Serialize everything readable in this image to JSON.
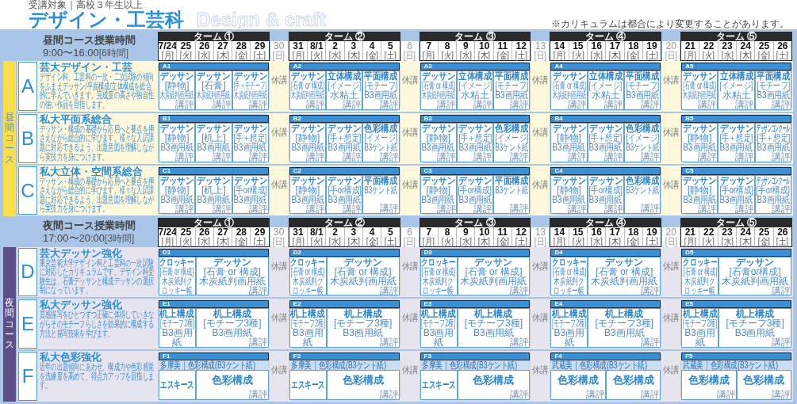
{
  "header": {
    "audience": "受講対象｜高校３年生以上",
    "title": "デザイン・工芸科",
    "title_en": "Design & craft",
    "note": "※カリキュラムは都合により変更することがあります。"
  },
  "sections": [
    {
      "kind": "day",
      "band": "昼間コース",
      "hours_title": "昼間コース授業時間",
      "hours": "9:00〜16:00",
      "duration": "[6時間]",
      "terms": [
        {
          "label": "ターム ①",
          "days": [
            {
              "date": "7/24",
              "weekday": "[月]"
            },
            {
              "date": "25",
              "weekday": "[火]"
            },
            {
              "date": "26",
              "weekday": "[水]"
            },
            {
              "date": "27",
              "weekday": "[木]"
            },
            {
              "date": "28",
              "weekday": "[金]"
            },
            {
              "date": "29",
              "weekday": "[土]"
            }
          ]
        },
        {
          "label": "ターム ②",
          "days": [
            {
              "date": "31",
              "weekday": "[月]"
            },
            {
              "date": "8/1",
              "weekday": "[火]"
            },
            {
              "date": "2",
              "weekday": "[水]"
            },
            {
              "date": "3",
              "weekday": "[木]"
            },
            {
              "date": "4",
              "weekday": "[金]"
            },
            {
              "date": "5",
              "weekday": "[土]"
            }
          ]
        },
        {
          "label": "ターム ③",
          "days": [
            {
              "date": "7",
              "weekday": "[月]"
            },
            {
              "date": "8",
              "weekday": "[火]"
            },
            {
              "date": "9",
              "weekday": "[水]"
            },
            {
              "date": "10",
              "weekday": "[木]"
            },
            {
              "date": "11",
              "weekday": "[金]"
            },
            {
              "date": "12",
              "weekday": "[土]"
            }
          ]
        },
        {
          "label": "ターム ④",
          "days": [
            {
              "date": "14",
              "weekday": "[月]"
            },
            {
              "date": "15",
              "weekday": "[火]"
            },
            {
              "date": "16",
              "weekday": "[水]"
            },
            {
              "date": "17",
              "weekday": "[木]"
            },
            {
              "date": "18",
              "weekday": "[金]"
            },
            {
              "date": "19",
              "weekday": "[土]"
            }
          ]
        },
        {
          "label": "ターム ⑤",
          "days": [
            {
              "date": "21",
              "weekday": "[月]"
            },
            {
              "date": "22",
              "weekday": "[火]"
            },
            {
              "date": "23",
              "weekday": "[水]"
            },
            {
              "date": "24",
              "weekday": "[木]"
            },
            {
              "date": "25",
              "weekday": "[金]"
            },
            {
              "date": "26",
              "weekday": "[土]"
            }
          ]
        }
      ],
      "rest_days": [
        {
          "date": "30",
          "weekday": "[日]"
        },
        {
          "date": "6",
          "weekday": "[日]"
        },
        {
          "date": "13",
          "weekday": "[日]"
        },
        {
          "date": "20",
          "weekday": "[日]"
        }
      ],
      "courses": [
        {
          "letter": "A",
          "title": "芸大デザイン・工芸",
          "description": "デザイン科、工芸科の一次・二次試験の傾向をふまえデッサン/平面構成/立体構成を総合的に学んでいきます。完成度の高さや独自性の強い作品を目指します。",
          "breaks": [
            "休講",
            "休講",
            "休講",
            "休講"
          ],
          "sessions": [
            {
              "code": "A1",
              "cells": [
                {
                  "kind": "narrow",
                  "title": "デッサン",
                  "sub": "[静物]",
                  "material": "木炭紙判画用紙",
                  "review": "講評"
                },
                {
                  "kind": "narrow",
                  "title": "デッサン",
                  "sub": "[石膏]",
                  "material": "木炭紙判画用紙",
                  "review": "講評"
                },
                {
                  "kind": "narrow",
                  "title": "デッサン",
                  "sub": "[手＋モチーフ]",
                  "material": "木炭紙判画用紙",
                  "review": "講評"
                }
              ]
            },
            {
              "code": "A2",
              "cells": [
                {
                  "kind": "narrow",
                  "title": "デッサン",
                  "sub": "[石膏 or 構成]",
                  "material": "木炭紙判画用紙",
                  "review": "講評"
                },
                {
                  "kind": "narrow",
                  "title": "立体構成",
                  "sub": "[イメージ]",
                  "material": "水粘土",
                  "review": "講評"
                },
                {
                  "kind": "narrow",
                  "title": "平面構成",
                  "sub": "[モチーフ]",
                  "material": "B3画用紙",
                  "review": "講評"
                }
              ]
            },
            {
              "code": "A3",
              "cells": [
                {
                  "kind": "narrow",
                  "title": "デッサン",
                  "sub": "[石膏 or 構成]",
                  "material": "木炭紙判画用紙",
                  "review": "講評"
                },
                {
                  "kind": "narrow",
                  "title": "立体構成",
                  "sub": "[イメージ]",
                  "material": "水粘土",
                  "review": "講評"
                },
                {
                  "kind": "narrow",
                  "title": "平面構成",
                  "sub": "[モチーフ]",
                  "material": "B3画用紙",
                  "review": "講評"
                }
              ]
            },
            {
              "code": "A4",
              "cells": [
                {
                  "kind": "narrow",
                  "title": "デッサン",
                  "sub": "[石膏 or 構成]",
                  "material": "木炭紙判画用紙",
                  "review": "講評"
                },
                {
                  "kind": "narrow",
                  "title": "立体構成",
                  "sub": "[イメージ]",
                  "material": "水粘土",
                  "review": "講評"
                },
                {
                  "kind": "narrow",
                  "title": "平面構成",
                  "sub": "[モチーフ]",
                  "material": "B3画用紙",
                  "review": "講評"
                }
              ]
            },
            {
              "code": "A5",
              "cells": [
                {
                  "kind": "narrow",
                  "title": "デッサン",
                  "sub": "[石膏 or 構成]",
                  "material": "木炭紙判画用紙",
                  "review": "講評"
                },
                {
                  "kind": "narrow",
                  "title": "立体構成",
                  "sub": "[イメージ]",
                  "material": "水粘土",
                  "review": "講評"
                },
                {
                  "kind": "narrow",
                  "title": "平面構成",
                  "sub": "[モチーフ]",
                  "material": "B3画用紙",
                  "review": "講評"
                }
              ]
            }
          ]
        },
        {
          "letter": "B",
          "title": "私大平面系総合",
          "description": "デッサン・構成の基礎から応用へと要点を押さえながら総合的に学びます。様々な入試課題に対応できるよう、出題意図を理解しながら実技力を身につけます。",
          "breaks": [
            "休講",
            "休講",
            "休講",
            "休講"
          ],
          "sessions": [
            {
              "code": "B1",
              "cells": [
                {
                  "kind": "narrow",
                  "title": "デッサン",
                  "sub": "[静物]",
                  "material": "B3画用紙",
                  "review": "講評"
                },
                {
                  "kind": "narrow",
                  "title": "デッサン",
                  "sub": "[机上]",
                  "material": "B3画用紙",
                  "review": "講評"
                },
                {
                  "kind": "narrow",
                  "title": "デッサン",
                  "sub": "[手＋想定]",
                  "material": "B3画用紙",
                  "review": "講評"
                }
              ]
            },
            {
              "code": "B2",
              "cells": [
                {
                  "kind": "narrow",
                  "title": "デッサン",
                  "sub": "[静物]",
                  "material": "B3画用紙",
                  "review": "講評"
                },
                {
                  "kind": "narrow",
                  "title": "デッサン",
                  "sub": "[手＋想定]",
                  "material": "B3画用紙",
                  "review": "講評"
                },
                {
                  "kind": "narrow",
                  "title": "色彩構成",
                  "sub": "[イメージ]",
                  "material": "B3ケント紙",
                  "review": "講評"
                }
              ]
            },
            {
              "code": "B3",
              "cells": [
                {
                  "kind": "narrow",
                  "title": "デッサン",
                  "sub": "[静物]",
                  "material": "B3画用紙",
                  "review": "講評"
                },
                {
                  "kind": "narrow",
                  "title": "デッサン",
                  "sub": "[手＋想定]",
                  "material": "B3画用紙",
                  "review": "講評"
                },
                {
                  "kind": "narrow",
                  "title": "色彩構成",
                  "sub": "[イメージ]",
                  "material": "B3ケント紙",
                  "review": "講評"
                }
              ]
            },
            {
              "code": "B4",
              "cells": [
                {
                  "kind": "narrow",
                  "title": "デッサン",
                  "sub": "[静物]",
                  "material": "B3画用紙",
                  "review": "講評"
                },
                {
                  "kind": "narrow",
                  "title": "デッサン",
                  "sub": "[手＋想定]",
                  "material": "B3画用紙",
                  "review": "講評"
                },
                {
                  "kind": "narrow",
                  "title": "色彩構成",
                  "sub": "[イメージ]",
                  "material": "B3ケント紙",
                  "review": "講評"
                }
              ]
            },
            {
              "code": "B5",
              "cells": [
                {
                  "kind": "narrow",
                  "title": "デッサン",
                  "sub": "[静物]",
                  "material": "B3画用紙",
                  "review": "講評"
                },
                {
                  "kind": "narrow",
                  "title": "デッサン",
                  "sub": "[手＋想定]",
                  "material": "B3画用紙",
                  "review": "講評"
                },
                {
                  "kind": "narrow",
                  "title": "デッサンコンクール",
                  "sub": "[手＋想定]",
                  "material": "B3画用紙",
                  "review": "講評"
                }
              ]
            }
          ]
        },
        {
          "letter": "C",
          "title": "私大立体・空間系総合",
          "description": "デッサン・構成の基礎から応用へと要点を押さえながら総合的に学びます。様々な入試課題に対応できるよう、出題意図を理解しながら実技力を身につけます。",
          "breaks": [
            "休講",
            "休講",
            "休講",
            "休講"
          ],
          "sessions": [
            {
              "code": "C1",
              "cells": [
                {
                  "kind": "narrow",
                  "title": "デッサン",
                  "sub": "[静物]",
                  "material": "B3画用紙",
                  "review": "講評"
                },
                {
                  "kind": "narrow",
                  "title": "デッサン",
                  "sub": "[机上]",
                  "material": "B3画用紙",
                  "review": "講評"
                },
                {
                  "kind": "narrow",
                  "title": "デッサン",
                  "sub": "[手or構成]",
                  "material": "B3画用紙",
                  "review": "講評"
                }
              ]
            },
            {
              "code": "C2",
              "cells": [
                {
                  "kind": "narrow",
                  "title": "デッサン",
                  "sub": "[静物]",
                  "material": "B3画用紙",
                  "review": "講評"
                },
                {
                  "kind": "narrow",
                  "title": "デッサン",
                  "sub": "[手or構成]",
                  "material": "B3画用紙",
                  "review": "講評"
                },
                {
                  "kind": "narrow",
                  "title": "平面構成",
                  "material": "B3ケント紙",
                  "review": "講評"
                }
              ]
            },
            {
              "code": "C3",
              "cells": [
                {
                  "kind": "narrow",
                  "title": "デッサン",
                  "sub": "[静物]",
                  "material": "B3画用紙",
                  "review": "講評"
                },
                {
                  "kind": "narrow",
                  "title": "デッサン",
                  "sub": "[手or構成]",
                  "material": "B3画用紙",
                  "review": "講評"
                },
                {
                  "kind": "narrow",
                  "title": "平面構成",
                  "material": "B3ケント紙",
                  "review": "講評"
                }
              ]
            },
            {
              "code": "C4",
              "cells": [
                {
                  "kind": "narrow",
                  "title": "デッサン",
                  "sub": "[静物]",
                  "material": "B3画用紙",
                  "review": "講評"
                },
                {
                  "kind": "narrow",
                  "title": "デッサン",
                  "sub": "[手or構成]",
                  "material": "B3画用紙",
                  "review": "講評"
                },
                {
                  "kind": "narrow",
                  "title": "色彩構成",
                  "material": "B3ケント紙",
                  "review": "講評"
                }
              ]
            },
            {
              "code": "C5",
              "cells": [
                {
                  "kind": "narrow",
                  "title": "デッサン",
                  "sub": "[静物]",
                  "material": "B3画用紙",
                  "review": "講評"
                },
                {
                  "kind": "narrow",
                  "title": "デッサン",
                  "sub": "[手or構成]",
                  "material": "B3画用紙",
                  "review": "講評"
                },
                {
                  "kind": "narrow",
                  "title": "デッサンコンクール",
                  "sub": "[手or構成]",
                  "material": "B3画用紙",
                  "review": "講評"
                }
              ]
            }
          ]
        }
      ]
    },
    {
      "kind": "night",
      "band": "夜間コース",
      "hours_title": "夜間コース授業時間",
      "hours": "17:00〜20:00",
      "duration": "[3時間]",
      "terms": [
        {
          "label": "ターム ①",
          "days": [
            {
              "date": "7/24",
              "weekday": "[月]"
            },
            {
              "date": "25",
              "weekday": "[火]"
            },
            {
              "date": "26",
              "weekday": "[水]"
            },
            {
              "date": "27",
              "weekday": "[木]"
            },
            {
              "date": "28",
              "weekday": "[金]"
            },
            {
              "date": "29",
              "weekday": "[土]"
            }
          ]
        },
        {
          "label": "ターム ②",
          "days": [
            {
              "date": "31",
              "weekday": "[月]"
            },
            {
              "date": "8/1",
              "weekday": "[火]"
            },
            {
              "date": "2",
              "weekday": "[水]"
            },
            {
              "date": "3",
              "weekday": "[木]"
            },
            {
              "date": "4",
              "weekday": "[金]"
            },
            {
              "date": "5",
              "weekday": "[土]"
            }
          ]
        },
        {
          "label": "ターム ③",
          "days": [
            {
              "date": "7",
              "weekday": "[月]"
            },
            {
              "date": "8",
              "weekday": "[火]"
            },
            {
              "date": "9",
              "weekday": "[水]"
            },
            {
              "date": "10",
              "weekday": "[木]"
            },
            {
              "date": "11",
              "weekday": "[金]"
            },
            {
              "date": "12",
              "weekday": "[土]"
            }
          ]
        },
        {
          "label": "ターム ④",
          "days": [
            {
              "date": "14",
              "weekday": "[月]"
            },
            {
              "date": "15",
              "weekday": "[火]"
            },
            {
              "date": "16",
              "weekday": "[水]"
            },
            {
              "date": "17",
              "weekday": "[木]"
            },
            {
              "date": "18",
              "weekday": "[金]"
            },
            {
              "date": "19",
              "weekday": "[土]"
            }
          ]
        },
        {
          "label": "ターム ⑤",
          "days": [
            {
              "date": "21",
              "weekday": "[月]"
            },
            {
              "date": "22",
              "weekday": "[火]"
            },
            {
              "date": "23",
              "weekday": "[水]"
            },
            {
              "date": "24",
              "weekday": "[木]"
            },
            {
              "date": "25",
              "weekday": "[金]"
            },
            {
              "date": "26",
              "weekday": "[土]"
            }
          ]
        }
      ],
      "rest_days": [
        {
          "date": "30",
          "weekday": "[日]"
        },
        {
          "date": "6",
          "weekday": "[日]"
        },
        {
          "date": "13",
          "weekday": "[日]"
        },
        {
          "date": "20",
          "weekday": "[日]"
        }
      ],
      "courses": [
        {
          "letter": "D",
          "title": "芸大デッサン強化",
          "description": "東京芸術大学デザイン科と工芸科の一次試験に対応したカリキュラムです。デザイン科受験生は、石膏デッサンと構成デッサンの選択制になっています。",
          "breaks": [
            "休講",
            "休講",
            "休講",
            "休講"
          ],
          "sessions": [
            {
              "code": "D1",
              "cells": [
                {
                  "kind": "narrow",
                  "title": "クロッキー",
                  "sub": "[石膏 or 構成]",
                  "material": "木炭紙判クロッキー帳"
                },
                {
                  "kind": "wide",
                  "title": "デッサン",
                  "sub": "[石膏 or 構成]",
                  "material": "木炭紙判画用紙",
                  "review": "講評"
                }
              ]
            },
            {
              "code": "D2",
              "cells": [
                {
                  "kind": "narrow",
                  "title": "クロッキー",
                  "sub": "[石膏 or 構成]",
                  "material": "木炭紙判クロッキー帳"
                },
                {
                  "kind": "wide",
                  "title": "デッサン",
                  "sub": "[石膏 or 構成]",
                  "material": "木炭紙判画用紙",
                  "review": "講評"
                }
              ]
            },
            {
              "code": "D3",
              "cells": [
                {
                  "kind": "narrow",
                  "title": "クロッキー",
                  "sub": "[石膏 or 構成]",
                  "material": "木炭紙判クロッキー帳"
                },
                {
                  "kind": "wide",
                  "title": "デッサン",
                  "sub": "[石膏 or 構成]",
                  "material": "木炭紙判画用紙",
                  "review": "講評"
                }
              ]
            },
            {
              "code": "D4",
              "cells": [
                {
                  "kind": "narrow",
                  "title": "クロッキー",
                  "sub": "[石膏 or 構成]",
                  "material": "木炭紙判クロッキー帳"
                },
                {
                  "kind": "wide",
                  "title": "デッサン",
                  "sub": "[石膏 or 構成]",
                  "material": "木炭紙判画用紙",
                  "review": "講評"
                }
              ]
            },
            {
              "code": "D5",
              "cells": [
                {
                  "kind": "narrow",
                  "title": "クロッキー",
                  "sub": "[石膏 or 構成]",
                  "material": "木炭紙判クロッキー帳"
                },
                {
                  "kind": "wide",
                  "title": "デッサン",
                  "sub": "[石膏or構成]",
                  "material": "木炭紙判画用紙",
                  "review": "講評"
                }
              ]
            }
          ]
        },
        {
          "letter": "E",
          "title": "私大デッサン強化",
          "description": "質感描写をひとつずつ正確に体得していきながらそのモチーフらしさを効果的に構成する方法と描写技術を学びます。",
          "breaks": [
            "休講",
            "休講",
            "休講",
            "休講"
          ],
          "sessions": [
            {
              "code": "E1",
              "cells": [
                {
                  "kind": "narrow",
                  "title": "机上構成",
                  "sub": "[モチーフ2種]",
                  "material": "B3画用紙"
                },
                {
                  "kind": "wide",
                  "title": "机上構成",
                  "sub": "[モチーフ3種]",
                  "material": "B3画用紙",
                  "review": "講評"
                }
              ]
            },
            {
              "code": "E2",
              "cells": [
                {
                  "kind": "narrow",
                  "title": "机上構成",
                  "sub": "[モチーフ2種]",
                  "material": "B3画用紙"
                },
                {
                  "kind": "wide",
                  "title": "机上構成",
                  "sub": "[モチーフ3種]",
                  "material": "B3画用紙",
                  "review": "講評"
                }
              ]
            },
            {
              "code": "E3",
              "cells": [
                {
                  "kind": "narrow",
                  "title": "机上構成",
                  "sub": "[モチーフ2種]",
                  "material": "B3画用紙"
                },
                {
                  "kind": "wide",
                  "title": "机上構成",
                  "sub": "[モチーフ3種]",
                  "material": "B3画用紙",
                  "review": "講評"
                }
              ]
            },
            {
              "code": "E4",
              "cells": [
                {
                  "kind": "narrow",
                  "title": "机上構成",
                  "sub": "[モチーフ2種]",
                  "material": "B3画用紙"
                },
                {
                  "kind": "wide",
                  "title": "机上構成",
                  "sub": "[モチーフ3種]",
                  "material": "B3画用紙",
                  "review": "講評"
                }
              ]
            },
            {
              "code": "E5",
              "cells": [
                {
                  "kind": "narrow",
                  "title": "机上構成",
                  "sub": "[モチーフ2種]",
                  "material": "B3画用紙"
                },
                {
                  "kind": "wide",
                  "title": "机上構成",
                  "sub": "[モチーフ3種]",
                  "material": "B3画用紙",
                  "review": "講評"
                }
              ]
            }
          ]
        },
        {
          "letter": "F",
          "title": "私大色彩強化",
          "description": "近年の出題傾向にあわせ、構成力や色彩感覚を洗練度を高めて、得点力アップを目指します。",
          "breaks": [
            "休講",
            "休講",
            "休講",
            "休講"
          ],
          "sessions": [
            {
              "code": "F1",
              "banner": "多摩美｜色彩構成(B3ケント紙)",
              "cells": [
                {
                  "kind": "narrow",
                  "title": "エスキース"
                },
                {
                  "kind": "wide",
                  "title": "色彩構成",
                  "review": "講評"
                }
              ]
            },
            {
              "code": "F2",
              "banner": "多摩美｜色彩構成(B3ケント紙)",
              "cells": [
                {
                  "kind": "narrow",
                  "title": "エスキース"
                },
                {
                  "kind": "wide",
                  "title": "色彩構成",
                  "review": "講評"
                }
              ]
            },
            {
              "code": "F3",
              "banner": "多摩美｜色彩構成(B3ケント紙)",
              "cells": [
                {
                  "kind": "narrow",
                  "title": "エスキース"
                },
                {
                  "kind": "wide",
                  "title": "色彩構成",
                  "review": "講評"
                }
              ]
            },
            {
              "code": "F4",
              "banner": "武蔵美｜色彩構成(B3ケント紙)",
              "cells": [
                {
                  "kind": "half",
                  "title": "色彩構成",
                  "review": "講評"
                },
                {
                  "kind": "half",
                  "title": "色彩構成",
                  "review": "講評"
                }
              ]
            },
            {
              "code": "F5",
              "banner": "武蔵美｜色彩構成(B3ケント紙)",
              "cells": [
                {
                  "kind": "half",
                  "title": "色彩構成",
                  "review": "講評"
                },
                {
                  "kind": "half",
                  "title": "色彩構成",
                  "review": "講評"
                }
              ]
            }
          ]
        }
      ]
    }
  ]
}
